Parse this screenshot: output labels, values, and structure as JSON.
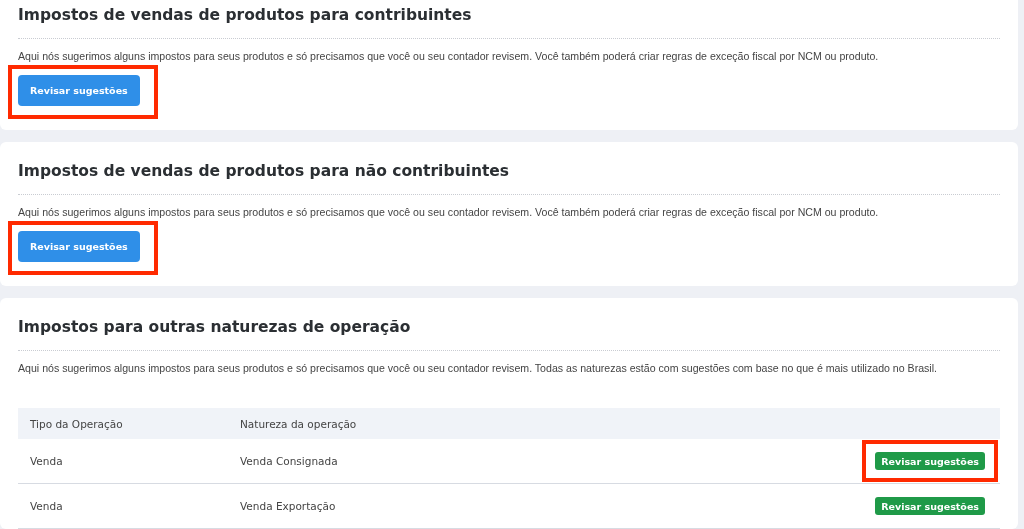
{
  "sections": [
    {
      "title": "Impostos de vendas de produtos para contribuintes",
      "description": "Aqui nós sugerimos alguns impostos para seus produtos e só precisamos que você ou seu contador revisem. Você também poderá criar regras de exceção fiscal por NCM ou produto.",
      "button": {
        "label": "Revisar sugestões",
        "highlighted": true
      }
    },
    {
      "title": "Impostos de vendas de produtos para não contribuintes",
      "description": "Aqui nós sugerimos alguns impostos para seus produtos e só precisamos que você ou seu contador revisem. Você também poderá criar regras de exceção fiscal por NCM ou produto.",
      "button": {
        "label": "Revisar sugestões",
        "highlighted": true
      }
    },
    {
      "title": "Impostos para outras naturezas de operação",
      "description": "Aqui nós sugerimos alguns impostos para seus produtos e só precisamos que você ou seu contador revisem. Todas as naturezas estão com sugestões com base no que é mais utilizado no Brasil.",
      "table": {
        "columns": [
          "Tipo da Operação",
          "Natureza da operação"
        ],
        "rows": [
          {
            "cells": [
              "Venda",
              "Venda Consignada"
            ],
            "button": {
              "label": "Revisar sugestões",
              "highlighted": true
            }
          },
          {
            "cells": [
              "Venda",
              "Venda Exportação"
            ],
            "button": {
              "label": "Revisar sugestões",
              "highlighted": false
            }
          }
        ]
      }
    }
  ]
}
